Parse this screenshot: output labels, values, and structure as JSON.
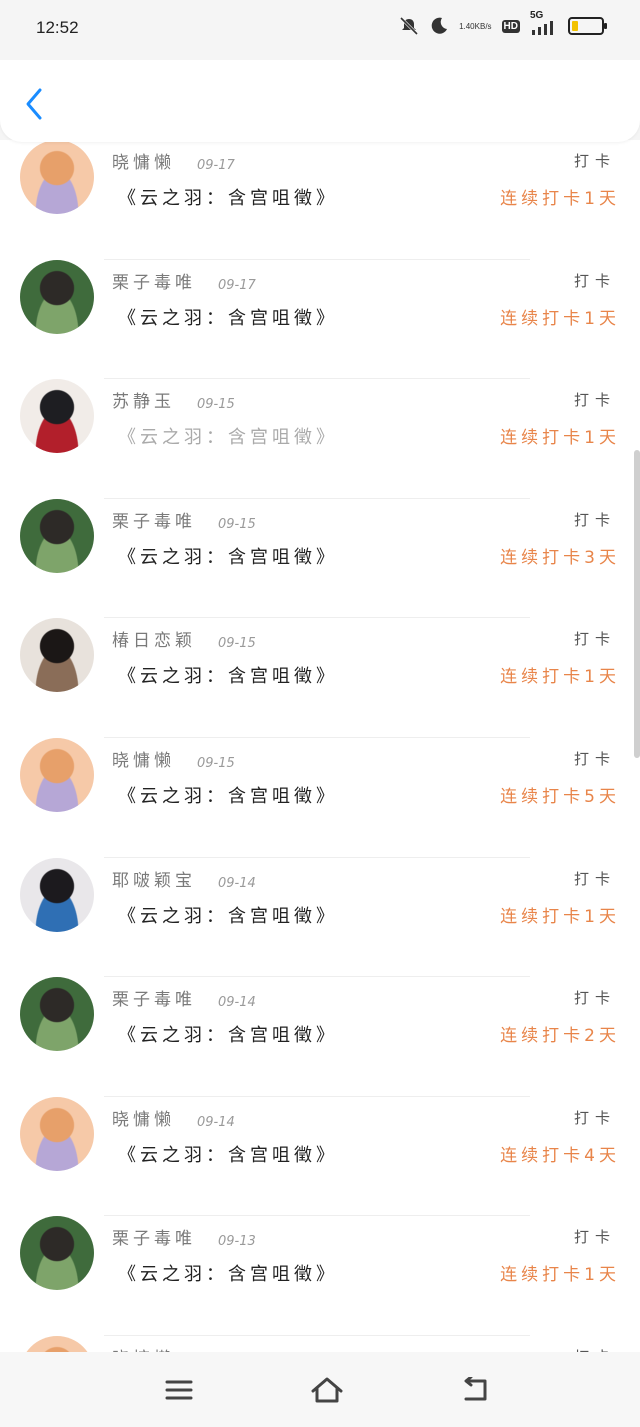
{
  "status_bar": {
    "time": "12:52",
    "net_speed_value": "1.40",
    "net_speed_unit": "KB/s",
    "hd_label": "HD",
    "network_label": "5G",
    "battery_level_fraction": 0.2,
    "battery_color": "#f2c200"
  },
  "header": {
    "back_icon": "chevron-left-icon",
    "accent_color": "#1a8cff"
  },
  "list": {
    "items": [
      {
        "name": "晓慵懒",
        "date": "09-17",
        "title": "《云之羽：含宫咀徵》",
        "tag": "打卡",
        "streak": "连续打卡1天",
        "avatar_colors": [
          "#f6c9a8",
          "#e7a06a",
          "#b6a7d6"
        ]
      },
      {
        "name": "栗子毒唯",
        "date": "09-17",
        "title": "《云之羽：含宫咀徵》",
        "tag": "打卡",
        "streak": "连续打卡1天",
        "avatar_colors": [
          "#3f6b3c",
          "#2d2a27",
          "#7ea46a"
        ]
      },
      {
        "name": "苏静玉",
        "date": "09-15",
        "title": "《云之羽：含宫咀徵》",
        "tag": "打卡",
        "streak": "连续打卡1天",
        "avatar_colors": [
          "#f1ece8",
          "#1e1e22",
          "#b21f2b"
        ]
      },
      {
        "name": "栗子毒唯",
        "date": "09-15",
        "title": "《云之羽：含宫咀徵》",
        "tag": "打卡",
        "streak": "连续打卡3天",
        "avatar_colors": [
          "#3f6b3c",
          "#2d2a27",
          "#7ea46a"
        ]
      },
      {
        "name": "椿日恋颖",
        "date": "09-15",
        "title": "《云之羽：含宫咀徵》",
        "tag": "打卡",
        "streak": "连续打卡1天",
        "avatar_colors": [
          "#e8e2dc",
          "#1b1716",
          "#8a6d58"
        ]
      },
      {
        "name": "晓慵懒",
        "date": "09-15",
        "title": "《云之羽：含宫咀徵》",
        "tag": "打卡",
        "streak": "连续打卡5天",
        "avatar_colors": [
          "#f6c9a8",
          "#e7a06a",
          "#b6a7d6"
        ]
      },
      {
        "name": "耶啵颖宝",
        "date": "09-14",
        "title": "《云之羽：含宫咀徵》",
        "tag": "打卡",
        "streak": "连续打卡1天",
        "avatar_colors": [
          "#e9e7ea",
          "#1c1a1e",
          "#2f6fb4"
        ]
      },
      {
        "name": "栗子毒唯",
        "date": "09-14",
        "title": "《云之羽：含宫咀徵》",
        "tag": "打卡",
        "streak": "连续打卡2天",
        "avatar_colors": [
          "#3f6b3c",
          "#2d2a27",
          "#7ea46a"
        ]
      },
      {
        "name": "晓慵懒",
        "date": "09-14",
        "title": "《云之羽：含宫咀徵》",
        "tag": "打卡",
        "streak": "连续打卡4天",
        "avatar_colors": [
          "#f6c9a8",
          "#e7a06a",
          "#b6a7d6"
        ]
      },
      {
        "name": "栗子毒唯",
        "date": "09-13",
        "title": "《云之羽：含宫咀徵》",
        "tag": "打卡",
        "streak": "连续打卡1天",
        "avatar_colors": [
          "#3f6b3c",
          "#2d2a27",
          "#7ea46a"
        ]
      },
      {
        "name": "晓慵懒",
        "date": "",
        "title": "",
        "tag": "打卡",
        "streak": "",
        "avatar_colors": [
          "#f6c9a8",
          "#e7a06a",
          "#b6a7d6"
        ]
      }
    ]
  },
  "nav_bar": {
    "menu_icon": "menu-icon",
    "home_icon": "home-icon",
    "back_icon": "back-arrow-icon"
  }
}
